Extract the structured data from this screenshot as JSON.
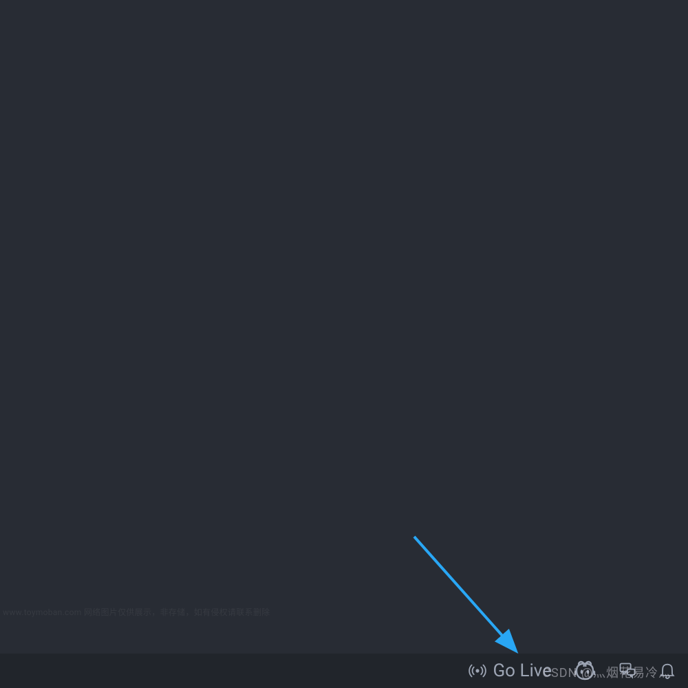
{
  "statusBar": {
    "goLive": {
      "label": "Go Live"
    }
  },
  "watermarks": {
    "topFaded": "www.toymoban.com 网络图片仅供展示，非存储，如有侵权请联系删除",
    "csdn": "CSDN @灬烟花易冷灬"
  },
  "annotation": {
    "arrowColor": "#29a7f5"
  }
}
